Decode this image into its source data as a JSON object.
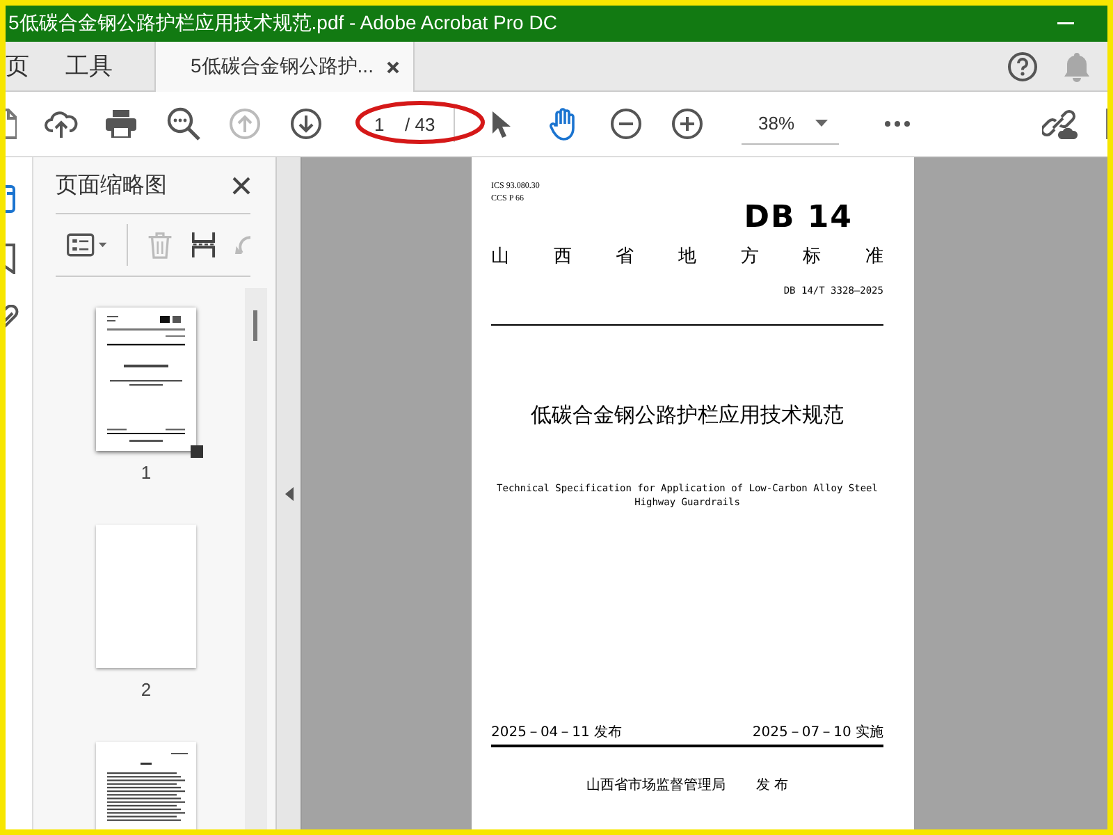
{
  "window": {
    "title": "5低碳合金钢公路护栏应用技术规范.pdf - Adobe Acrobat Pro DC"
  },
  "tabs": [
    {
      "label": "页",
      "kind": "nav",
      "selected": false
    },
    {
      "label": "工具",
      "kind": "nav",
      "selected": false
    },
    {
      "label": "5低碳合金钢公路护...",
      "kind": "doc",
      "selected": true
    }
  ],
  "toolbar": {
    "previous_page_disabled": true,
    "page": {
      "value": "1",
      "total": "/ 43",
      "circled": true
    },
    "zoom": "38%"
  },
  "sidebar": {
    "title": "页面缩略图",
    "delete_disabled": true,
    "rotate_disabled": true,
    "thumbnails": [
      {
        "kind": "cover",
        "label": "1",
        "selected": true
      },
      {
        "kind": "blank",
        "label": "2",
        "selected": false
      },
      {
        "kind": "contents",
        "selected": false
      }
    ]
  },
  "page": {
    "codes": [
      "ICS 93.080.30",
      "CCS P 66"
    ],
    "code": "DB 14",
    "category": "山 西 省 地 方 标 准",
    "number": "DB 14/T 3328—2025",
    "title_zh": "低碳合金钢公路护栏应用技术规范",
    "title_en": "Technical Specification for Application of Low-Carbon Alloy Steel Highway Guardrails",
    "issue_date": "2025－04－11 发布",
    "effective_date": "2025－07－10 实施",
    "issuer": "山西省市场监督管理局",
    "issuer_action": "发 布"
  }
}
